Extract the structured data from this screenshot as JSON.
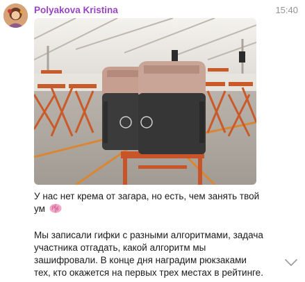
{
  "message": {
    "sender": "Polyakova Kristina",
    "time": "15:40",
    "paragraph1": "У нас нет крема от загара, но есть, чем занять твой ум",
    "paragraph2": "Мы записали гифки с разными алгоритмами, задача участника отгадать, какой алгоритм мы зашифровали. В конце дня наградим рюкзаками тех, кто окажется на первых трех местах в рейтинге."
  },
  "icons": {
    "emoji": "brain-emoji",
    "scroll": "chevron-down-icon"
  },
  "colors": {
    "sender_name": "#9a43c4",
    "time": "#8e9399",
    "text": "#1a1a1a"
  }
}
